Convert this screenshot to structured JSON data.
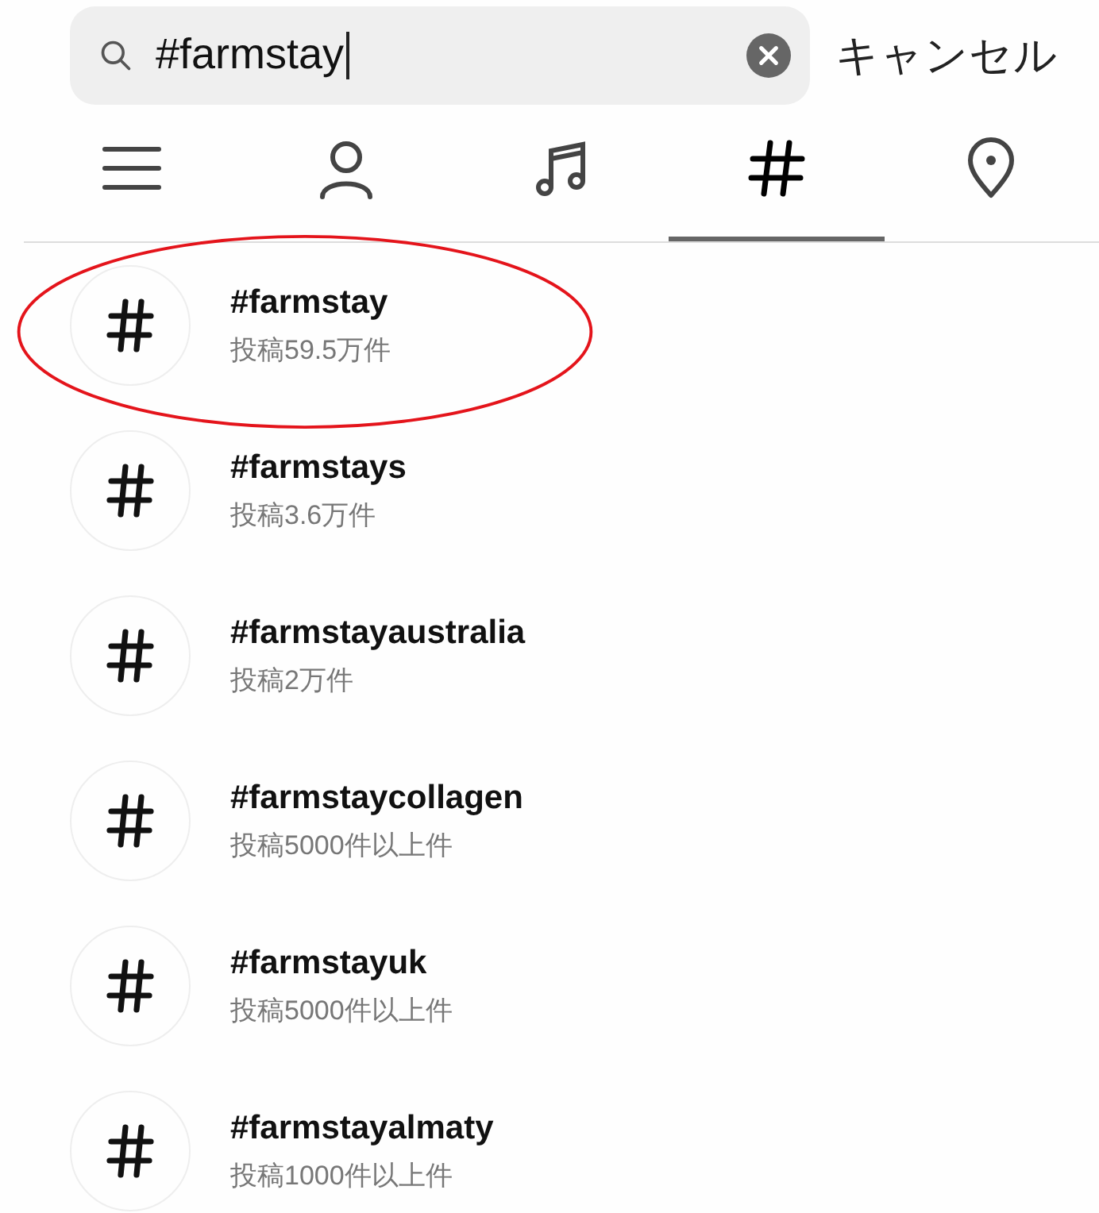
{
  "search": {
    "value": "#farmstay",
    "cancel": "キャンセル"
  },
  "tabs": [
    {
      "kind": "menu",
      "selected": false
    },
    {
      "kind": "account",
      "selected": false
    },
    {
      "kind": "audio",
      "selected": false
    },
    {
      "kind": "tag",
      "selected": true
    },
    {
      "kind": "place",
      "selected": false
    }
  ],
  "results": [
    {
      "tag": "#farmstay",
      "posts": "投稿59.5万件",
      "highlighted": true
    },
    {
      "tag": "#farmstays",
      "posts": "投稿3.6万件",
      "highlighted": false
    },
    {
      "tag": "#farmstayaustralia",
      "posts": "投稿2万件",
      "highlighted": false
    },
    {
      "tag": "#farmstaycollagen",
      "posts": "投稿5000件以上件",
      "highlighted": false
    },
    {
      "tag": "#farmstayuk",
      "posts": "投稿5000件以上件",
      "highlighted": false
    },
    {
      "tag": "#farmstayalmaty",
      "posts": "投稿1000件以上件",
      "highlighted": false
    }
  ]
}
